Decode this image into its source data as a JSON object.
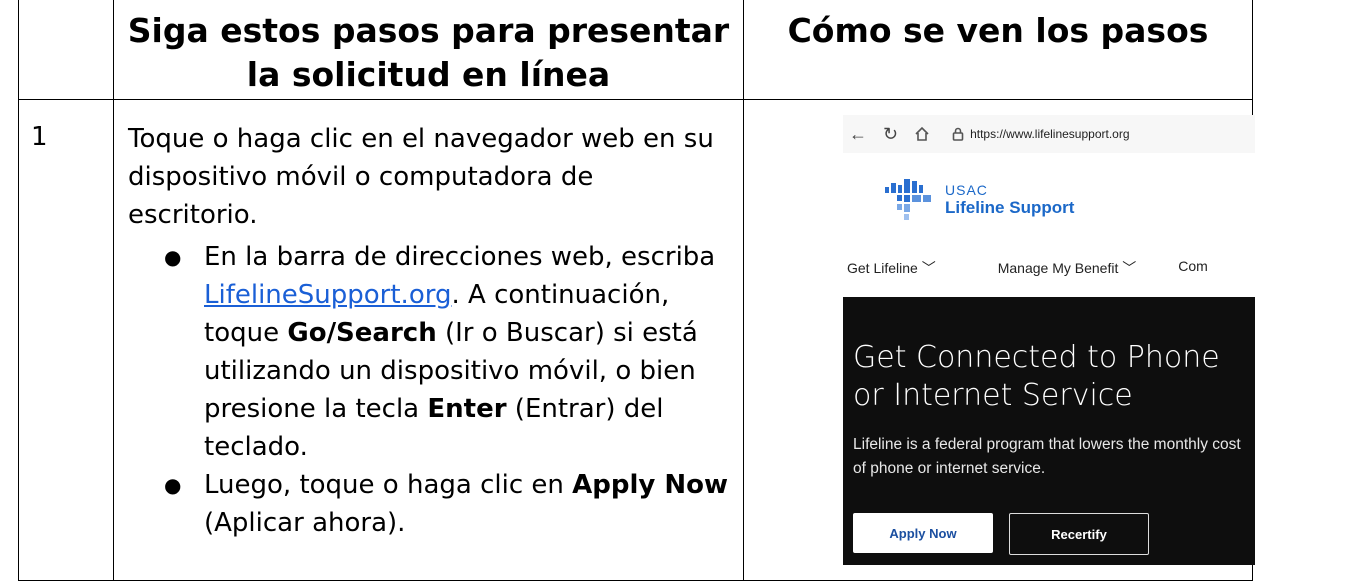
{
  "table": {
    "header_col2": "Siga estos pasos para presentar la solicitud en línea",
    "header_col3": "Cómo se ven los pasos"
  },
  "step": {
    "number": "1",
    "intro": "Toque o haga clic en el navegador web en su dispositivo móvil o computadora de escritorio.",
    "bullet1": {
      "before_link": "En la barra de direcciones web, escriba ",
      "link": "LifelineSupport.org",
      "after_link": ". A continuación, toque ",
      "go_search": "Go/Search",
      "middle": " (Ir o Buscar) si está utilizando un dispositivo móvil, o bien presione la tecla ",
      "enter": "Enter",
      "end": " (Entrar) del teclado."
    },
    "bullet2": {
      "before": "Luego, toque o haga clic en ",
      "apply_now": "Apply Now",
      "after": " (Aplicar ahora)."
    }
  },
  "screenshot": {
    "url": "https://www.lifelinesupport.org",
    "logo_org": "USAC",
    "logo_name": "Lifeline Support",
    "nav": [
      "Get Lifeline",
      "Manage My Benefit",
      "Com"
    ],
    "hero_title_line1": "Get Connected to Phone",
    "hero_title_line2": "or Internet Service",
    "hero_text": "Lifeline is a federal program that lowers the monthly cost of phone or internet service.",
    "apply_button": "Apply Now",
    "recertify_button": "Recertify"
  },
  "colors": {
    "link": "#1a5fd6",
    "brand_blue": "#1b68c8",
    "hero_bg": "#0e0e0e"
  }
}
